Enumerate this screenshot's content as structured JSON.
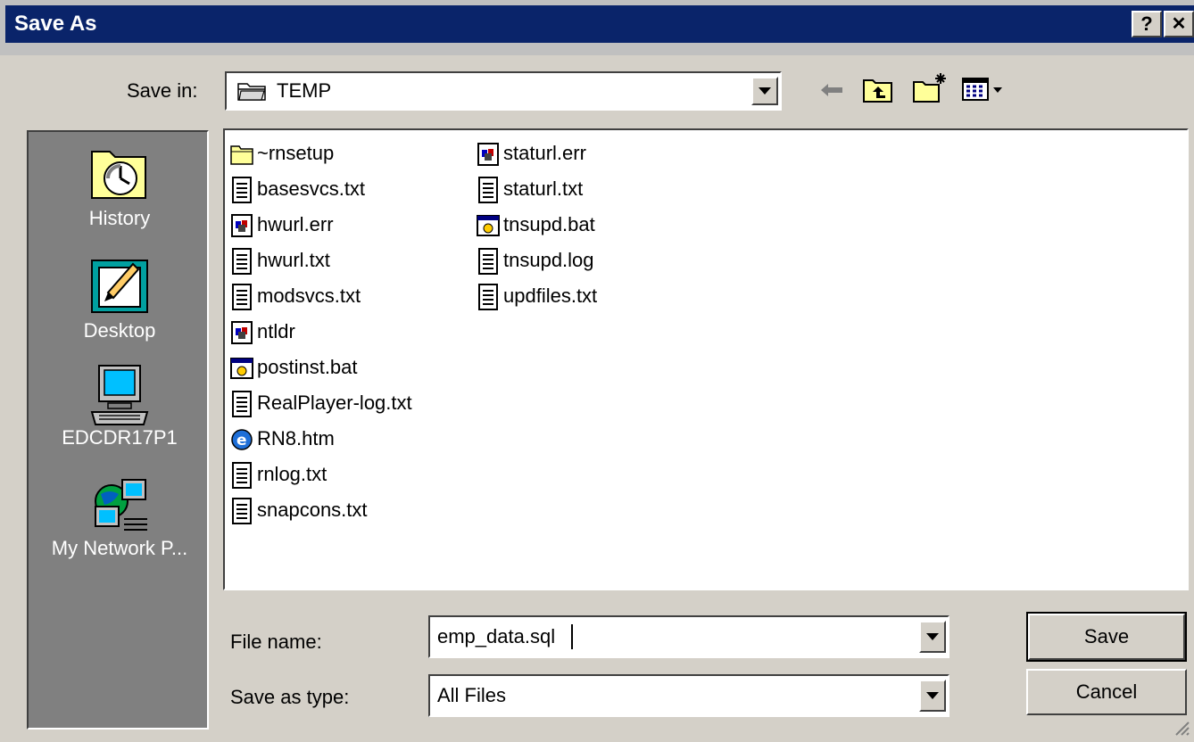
{
  "window": {
    "title": "Save As",
    "help_glyph": "?",
    "close_glyph": "✕"
  },
  "save_in": {
    "label": "Save in:",
    "value": "TEMP"
  },
  "toolbar": {
    "back_icon": "back-arrow-icon",
    "up_icon": "up-one-level-icon",
    "new_folder_icon": "create-new-folder-icon",
    "view_icon": "view-menu-icon"
  },
  "places": [
    {
      "label": "History",
      "icon": "history-icon"
    },
    {
      "label": "Desktop",
      "icon": "desktop-icon"
    },
    {
      "label": "EDCDR17P1",
      "icon": "computer-icon"
    },
    {
      "label": "My Network P...",
      "icon": "network-icon"
    }
  ],
  "files": {
    "column1": [
      {
        "name": "~rnsetup",
        "type": "folder"
      },
      {
        "name": "basesvcs.txt",
        "type": "text"
      },
      {
        "name": "hwurl.err",
        "type": "system"
      },
      {
        "name": "hwurl.txt",
        "type": "text"
      },
      {
        "name": "modsvcs.txt",
        "type": "text"
      },
      {
        "name": "ntldr",
        "type": "system"
      },
      {
        "name": "postinst.bat",
        "type": "batch"
      },
      {
        "name": "RealPlayer-log.txt",
        "type": "text"
      },
      {
        "name": "RN8.htm",
        "type": "html"
      },
      {
        "name": "rnlog.txt",
        "type": "text"
      },
      {
        "name": "snapcons.txt",
        "type": "text"
      }
    ],
    "column2": [
      {
        "name": "staturl.err",
        "type": "system"
      },
      {
        "name": "staturl.txt",
        "type": "text"
      },
      {
        "name": "tnsupd.bat",
        "type": "batch"
      },
      {
        "name": "tnsupd.log",
        "type": "text"
      },
      {
        "name": "updfiles.txt",
        "type": "text"
      }
    ]
  },
  "file_name": {
    "label": "File name:",
    "value": "emp_data.sql"
  },
  "save_as_type": {
    "label": "Save as type:",
    "value": "All Files"
  },
  "buttons": {
    "save": "Save",
    "cancel": "Cancel"
  },
  "colors": {
    "title_bar": "#0a246a",
    "face": "#d4d0c8",
    "places_bar": "#808080"
  }
}
